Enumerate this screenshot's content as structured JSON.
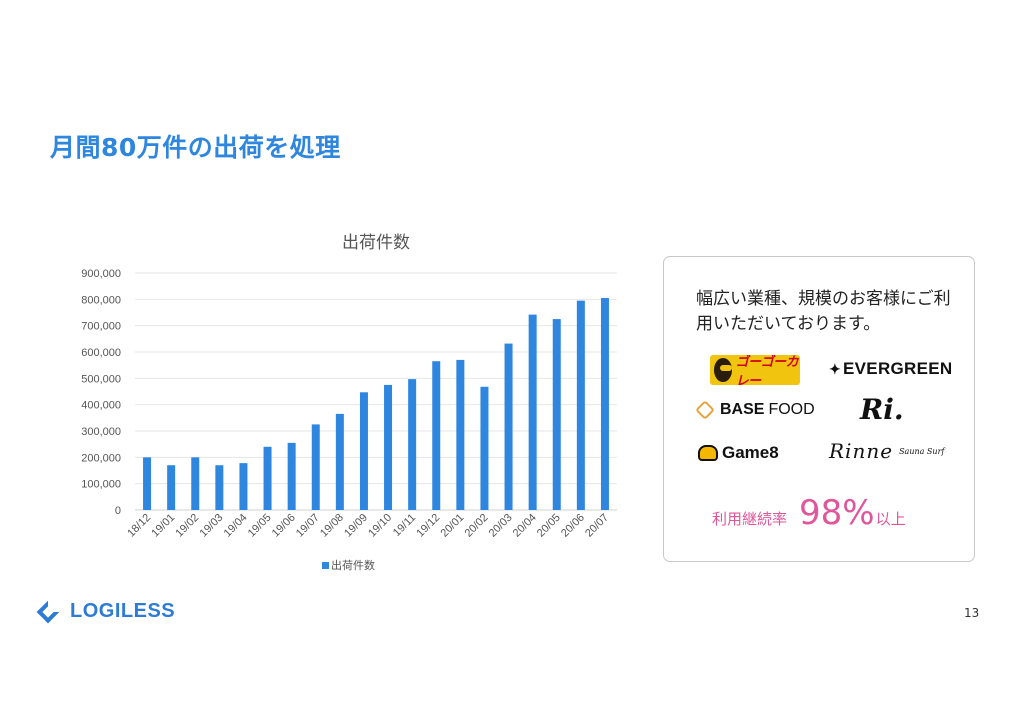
{
  "slide": {
    "title": "月間80万件の出荷を処理",
    "page_number": "13"
  },
  "card": {
    "text": "幅広い業種、規模のお客様にご利用いただいております。",
    "logos": {
      "gogo": "ゴーゴーカレー",
      "evergreen": "EVERGREEN",
      "base_food_bold": "BASE",
      "base_food_rest": "FOOD",
      "ri": "Ri.",
      "game8": "Game8",
      "rinne": "Rinne",
      "rinne_sub": "Sauna Surf"
    },
    "retention_label": "利用継続率",
    "retention_value": "98%",
    "retention_suffix": "以上"
  },
  "brand": {
    "logo_text": "LOGILESS",
    "accent": "#2e7bd6",
    "pink": "#e0569a"
  },
  "chart_data": {
    "type": "bar",
    "title": "出荷件数",
    "categories": [
      "18/12",
      "19/01",
      "19/02",
      "19/03",
      "19/04",
      "19/05",
      "19/06",
      "19/07",
      "19/08",
      "19/09",
      "19/10",
      "19/11",
      "19/12",
      "20/01",
      "20/02",
      "20/03",
      "20/04",
      "20/05",
      "20/06",
      "20/07"
    ],
    "series": [
      {
        "name": "出荷件数",
        "color": "#2e86de",
        "values": [
          200000,
          170000,
          200000,
          170000,
          178000,
          240000,
          255000,
          325000,
          365000,
          447000,
          475000,
          497000,
          565000,
          570000,
          468000,
          632000,
          742000,
          725000,
          795000,
          805000
        ]
      }
    ],
    "ylim": [
      0,
      900000
    ],
    "yticks": [
      0,
      100000,
      200000,
      300000,
      400000,
      500000,
      600000,
      700000,
      800000,
      900000
    ],
    "ytick_labels": [
      "0",
      "100,000",
      "200,000",
      "300,000",
      "400,000",
      "500,000",
      "600,000",
      "700,000",
      "800,000",
      "900,000"
    ],
    "grid": true,
    "legend": "bottom"
  }
}
